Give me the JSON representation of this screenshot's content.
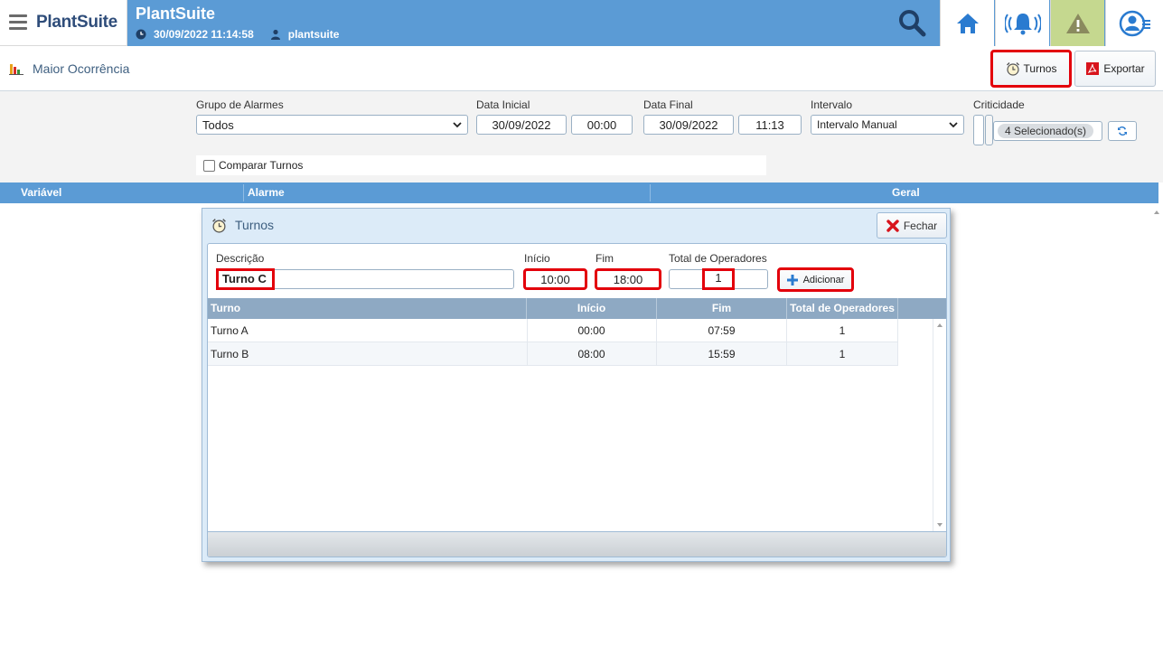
{
  "topbar": {
    "brand": "PlantSuite",
    "title": "PlantSuite",
    "datetime": "30/09/2022 11:14:58",
    "user": "plantsuite"
  },
  "page": {
    "title": "Maior Ocorrência",
    "turnos_label": "Turnos",
    "export_label": "Exportar"
  },
  "filters": {
    "group_label": "Grupo de Alarmes",
    "group_value": "Todos",
    "start_label": "Data Inicial",
    "start_date": "30/09/2022",
    "start_time": "00:00",
    "end_label": "Data Final",
    "end_date": "30/09/2022",
    "end_time": "11:13",
    "interval_label": "Intervalo",
    "interval_value": "Intervalo Manual",
    "criticality_label": "Criticidade",
    "criticality_value": "4 Selecionado(s)",
    "compare_label": "Comparar Turnos"
  },
  "grid": {
    "columns": [
      "Variável",
      "Alarme",
      "Geral"
    ]
  },
  "modal": {
    "title": "Turnos",
    "close_label": "Fechar",
    "description_label": "Descrição",
    "description_value": "Turno C",
    "start_label": "Início",
    "start_value": "10:00",
    "end_label": "Fim",
    "end_value": "18:00",
    "operators_label": "Total de Operadores",
    "operators_value": "1",
    "add_label": "Adicionar",
    "table_headers": [
      "Turno",
      "Início",
      "Fim",
      "Total de Operadores"
    ],
    "rows": [
      {
        "turno": "Turno A",
        "inicio": "00:00",
        "fim": "07:59",
        "operadores": "1"
      },
      {
        "turno": "Turno B",
        "inicio": "08:00",
        "fim": "15:59",
        "operadores": "1"
      }
    ]
  },
  "colors": {
    "topbar": "#5b9bd5",
    "highlight": "#e3000b",
    "alert_tile": "#c5d88f"
  }
}
